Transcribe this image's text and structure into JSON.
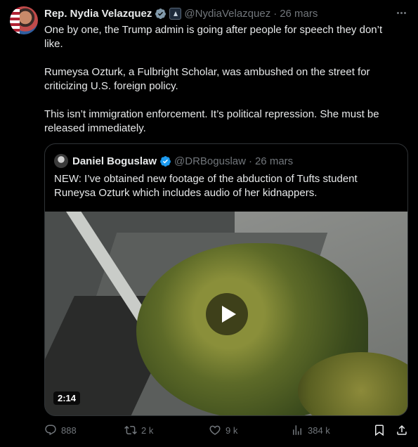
{
  "author": {
    "name": "Rep. Nydia Velazquez",
    "handle": "@NydiaVelazquez",
    "separator": "·",
    "time": "26 mars"
  },
  "tweet": {
    "paragraphs": [
      "One by one, the Trump admin is going after people for speech they don’t like.",
      "Rumeysa Ozturk, a Fulbright Scholar, was ambushed on the street for criticizing U.S. foreign policy.",
      "This isn’t immigration enforcement. It’s political repression. She must be released immediately."
    ]
  },
  "quote": {
    "name": "Daniel Boguslaw",
    "handle": "@DRBoguslaw",
    "separator": "·",
    "time": "26 mars",
    "text": "NEW: I’ve obtained new footage of the abduction of Tufts student Runeysa Ozturk which includes audio of her kidnappers.",
    "video": {
      "duration": "2:14"
    }
  },
  "actions": {
    "replies": "888",
    "retweets": "2 k",
    "likes": "9 k",
    "views": "384 k"
  },
  "colors": {
    "background": "#000000",
    "text": "#e7e9ea",
    "muted": "#71767b",
    "verified": "#1d9bf0",
    "border": "#2f3336"
  },
  "icons": [
    "verified-badge-icon",
    "government-badge-icon",
    "more-icon",
    "play-icon",
    "reply-icon",
    "retweet-icon",
    "like-icon",
    "views-icon",
    "bookmark-icon",
    "share-icon"
  ]
}
